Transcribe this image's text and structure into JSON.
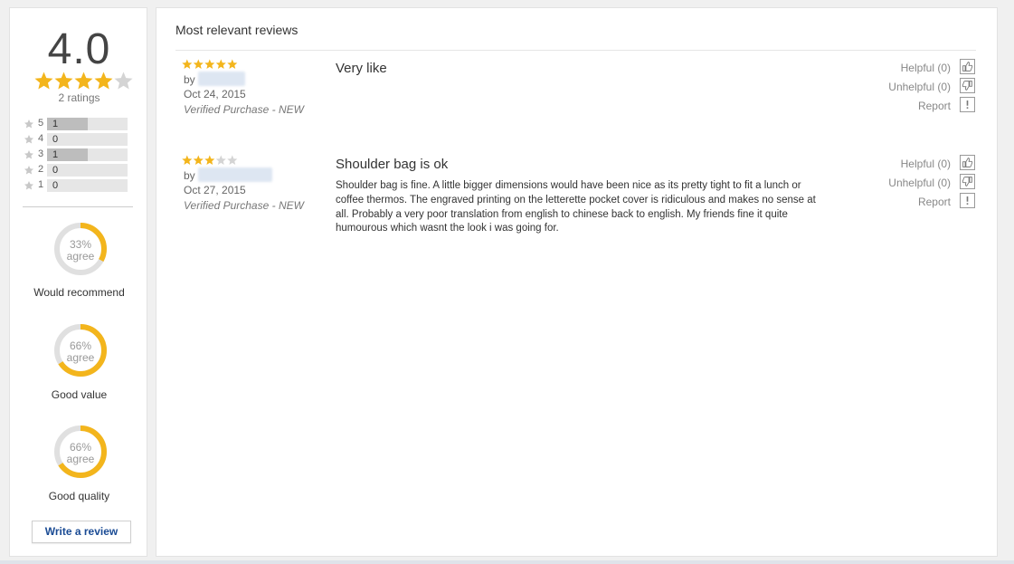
{
  "summary": {
    "average": "4.0",
    "average_stars": 4,
    "ratings_count": "2 ratings",
    "histogram": [
      {
        "star": "5",
        "count": "1",
        "fraction": 0.5
      },
      {
        "star": "4",
        "count": "0",
        "fraction": 0
      },
      {
        "star": "3",
        "count": "1",
        "fraction": 0.5
      },
      {
        "star": "2",
        "count": "0",
        "fraction": 0
      },
      {
        "star": "1",
        "count": "0",
        "fraction": 0
      }
    ],
    "metrics": [
      {
        "percent": "33%",
        "agree": "agree",
        "label": "Would recommend",
        "fraction": 0.33
      },
      {
        "percent": "66%",
        "agree": "agree",
        "label": "Good value",
        "fraction": 0.66
      },
      {
        "percent": "66%",
        "agree": "agree",
        "label": "Good quality",
        "fraction": 0.66
      }
    ],
    "write_review": "Write a review"
  },
  "reviews_header": "Most relevant reviews",
  "reviews": [
    {
      "stars": 5,
      "by": "by",
      "date": "Oct 24, 2015",
      "verified": "Verified Purchase - ",
      "condition": "NEW",
      "title": "Very like",
      "body": "",
      "helpful": "Helpful (0)",
      "unhelpful": "Unhelpful (0)",
      "report": "Report"
    },
    {
      "stars": 3,
      "by": "by",
      "date": "Oct 27, 2015",
      "verified": "Verified Purchase - ",
      "condition": "NEW",
      "title": "Shoulder bag is ok",
      "body": "Shoulder bag is fine. A little bigger dimensions would have been nice as its pretty tight to fit a lunch or coffee thermos. The  engraved printing on the letterette pocket cover is ridiculous and makes no sense at all. Probably a very poor translation from english to chinese back to english. My friends fine it quite humourous which wasnt the look i was going for.",
      "helpful": "Helpful (0)",
      "unhelpful": "Unhelpful (0)",
      "report": "Report"
    }
  ],
  "colors": {
    "star": "#f3b51c",
    "star_empty": "#d4d4d4",
    "donut": "#f3b51c",
    "donut_track": "#e0e0e0",
    "link": "#1a4b94"
  }
}
